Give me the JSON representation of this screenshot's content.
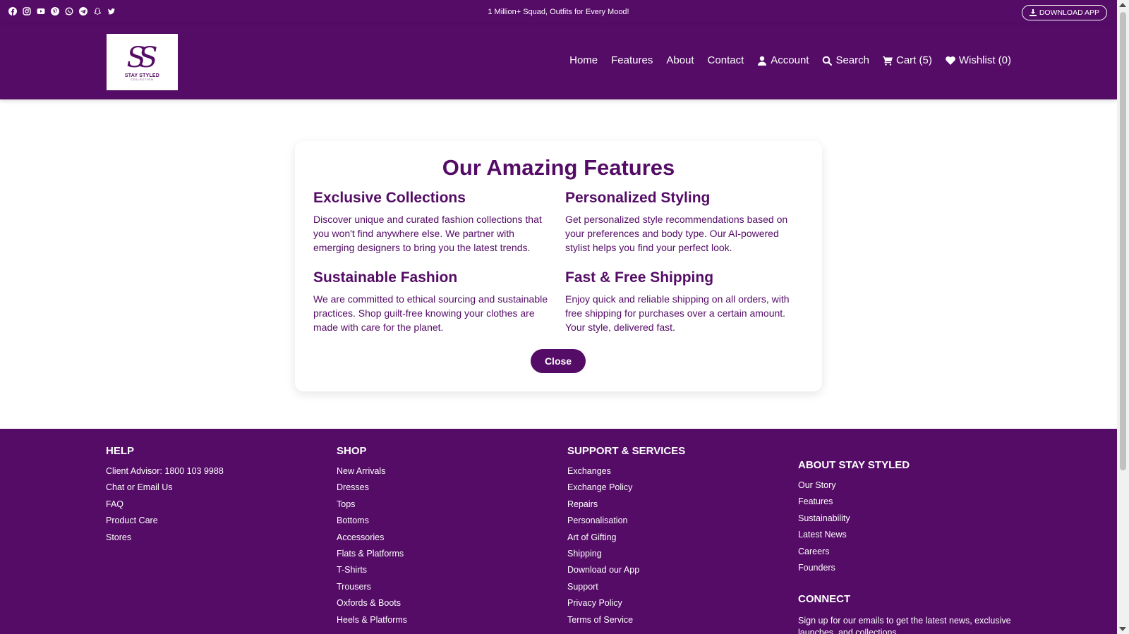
{
  "topbar": {
    "social_icons": [
      "facebook-icon",
      "instagram-icon",
      "youtube-icon",
      "pinterest-icon",
      "whatsapp-icon",
      "telegram-icon",
      "snapchat-icon",
      "twitter-icon"
    ],
    "announcement": "1 Million+ Squad, Outfits for Every Mood!",
    "download_label": "DOWNLOAD APP"
  },
  "brand": {
    "monogram": "SS",
    "name": "STAY STYLED",
    "tagline": "COLLECTION",
    "color": "#540c66"
  },
  "nav": {
    "home": "Home",
    "features": "Features",
    "about": "About",
    "contact": "Contact",
    "account": "Account",
    "search": "Search",
    "cart": "Cart (5)",
    "wishlist": "Wishlist (0)"
  },
  "modal": {
    "title": "Our Amazing Features",
    "features": [
      {
        "title": "Exclusive Collections",
        "text": "Discover unique and curated fashion collections that you won't find anywhere else. We partner with emerging designers to bring you the latest trends."
      },
      {
        "title": "Personalized Styling",
        "text": "Get personalized style recommendations based on your preferences and body type. Our AI-powered stylist helps you find your perfect look."
      },
      {
        "title": "Sustainable Fashion",
        "text": "We are committed to ethical sourcing and sustainable practices. Shop guilt-free knowing your clothes are made with care for the planet."
      },
      {
        "title": "Fast & Free Shipping",
        "text": "Enjoy quick and reliable shipping on all orders, with free shipping for purchases over a certain amount. Your style, delivered fast."
      }
    ],
    "close_label": "Close"
  },
  "footer": {
    "help": {
      "title": "HELP",
      "items": [
        "Client Advisor: 1800 103 9988",
        "Chat or Email Us",
        "FAQ",
        "Product Care",
        "Stores"
      ]
    },
    "shop": {
      "title": "SHOP",
      "items": [
        "New Arrivals",
        "Dresses",
        "Tops",
        "Bottoms",
        "Accessories",
        "Flats & Platforms",
        "T-Shirts",
        "Trousers",
        "Oxfords & Boots",
        "Heels & Platforms"
      ]
    },
    "support": {
      "title": "SUPPORT & SERVICES",
      "items": [
        "Exchanges",
        "Exchange Policy",
        "Repairs",
        "Personalisation",
        "Art of Gifting",
        "Shipping",
        "Download our App",
        "Support",
        "Privacy Policy",
        "Terms of Service"
      ]
    },
    "about": {
      "title": "ABOUT STAY STYLED",
      "items": [
        "Our Story",
        "Features",
        "Sustainability",
        "Latest News",
        "Careers",
        "Founders"
      ]
    },
    "connect": {
      "title": "CONNECT",
      "text": "Sign up for our emails to get the latest news, exclusive launches, and collections."
    }
  }
}
